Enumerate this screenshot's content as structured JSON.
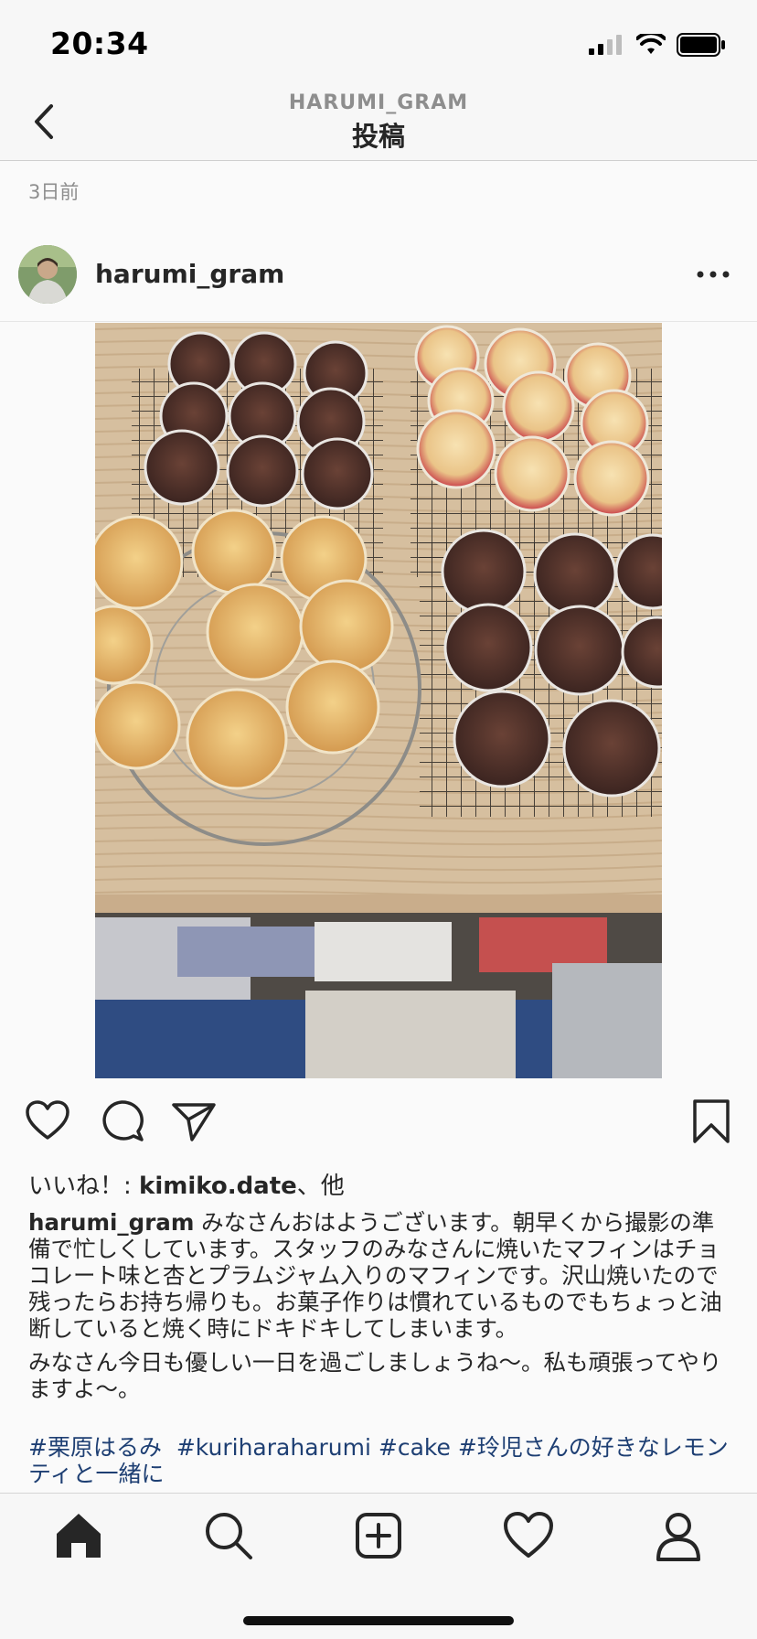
{
  "status_bar": {
    "time": "20:34"
  },
  "nav": {
    "account": "HARUMI_GRAM",
    "title": "投稿"
  },
  "post": {
    "timestamp": "3日前",
    "username": "harumi_gram",
    "likes_prefix": "いいね！: ",
    "likes_user": "kimiko.date",
    "likes_suffix": "、他",
    "caption_user": "harumi_gram",
    "caption_text": " みなさんおはようございます。朝早くから撮影の準備で忙しくしています。スタッフのみなさんに焼いたマフィンはチョコレート味と杏とプラムジャム入りのマフィンです。沢山焼いたので残ったらお持ち帰りも。お菓子作りは慣れているものでもちょっと油断していると焼く時にドキドキしてしまいます。",
    "caption_text2": "みなさん今日も優しい一日を過ごしましょうね〜。私も頑張ってやりますよ〜。",
    "hashtags": [
      "#栗原はるみ",
      "#kuriharaharumi",
      "#cake",
      "#玲児さんの好きなレモンティと一緒に"
    ]
  },
  "icons": {
    "back": "chevron-left-icon",
    "more": "more-dots-icon",
    "like": "heart-icon",
    "comment": "comment-icon",
    "share": "send-icon",
    "save": "bookmark-icon",
    "tabs": [
      "home-icon",
      "search-icon",
      "add-post-icon",
      "activity-heart-icon",
      "profile-icon"
    ]
  },
  "colors": {
    "hashtag": "#1e3f73",
    "muted": "#8e8e8e",
    "text": "#262626"
  }
}
